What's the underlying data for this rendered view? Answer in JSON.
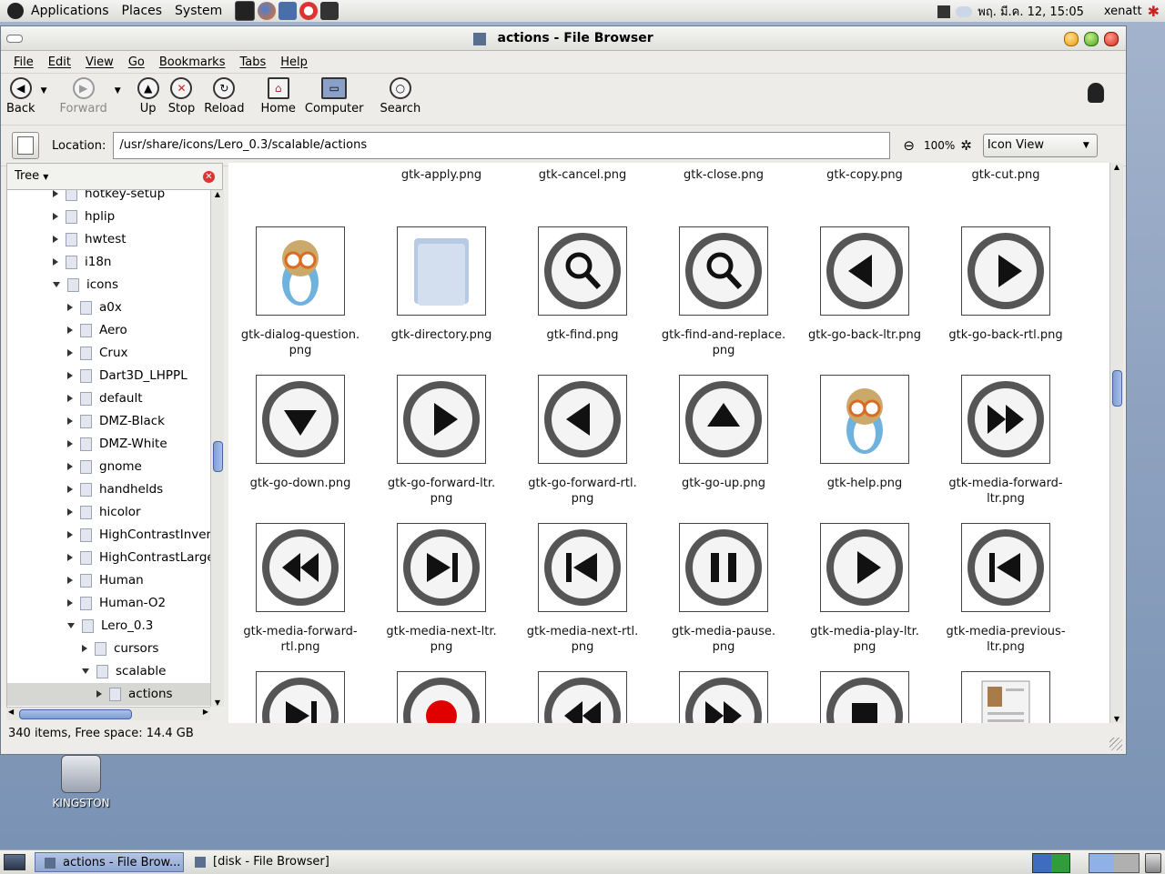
{
  "top_panel": {
    "menus": [
      "Applications",
      "Places",
      "System"
    ],
    "clock": "พฤ. มี.ค. 12, 15:05",
    "user": "xenatt"
  },
  "window": {
    "title": "actions - File Browser",
    "menu": [
      "File",
      "Edit",
      "View",
      "Go",
      "Bookmarks",
      "Tabs",
      "Help"
    ],
    "toolbar": {
      "back": "Back",
      "forward": "Forward",
      "up": "Up",
      "stop": "Stop",
      "reload": "Reload",
      "home": "Home",
      "computer": "Computer",
      "search": "Search"
    },
    "location": {
      "label": "Location:",
      "value": "/usr/share/icons/Lero_0.3/scalable/actions",
      "zoom": "100%",
      "view": "Icon View"
    },
    "side_pane": {
      "selector": "Tree",
      "tree": [
        {
          "label": "hotkey-setup",
          "level": 0,
          "expanded": false
        },
        {
          "label": "hplip",
          "level": 0,
          "expanded": false
        },
        {
          "label": "hwtest",
          "level": 0,
          "expanded": false
        },
        {
          "label": "i18n",
          "level": 0,
          "expanded": false
        },
        {
          "label": "icons",
          "level": 0,
          "expanded": true
        },
        {
          "label": "a0x",
          "level": 1,
          "expanded": false
        },
        {
          "label": "Aero",
          "level": 1,
          "expanded": false
        },
        {
          "label": "Crux",
          "level": 1,
          "expanded": false
        },
        {
          "label": "Dart3D_LHPPL",
          "level": 1,
          "expanded": false
        },
        {
          "label": "default",
          "level": 1,
          "expanded": false
        },
        {
          "label": "DMZ-Black",
          "level": 1,
          "expanded": false
        },
        {
          "label": "DMZ-White",
          "level": 1,
          "expanded": false
        },
        {
          "label": "gnome",
          "level": 1,
          "expanded": false
        },
        {
          "label": "handhelds",
          "level": 1,
          "expanded": false
        },
        {
          "label": "hicolor",
          "level": 1,
          "expanded": false
        },
        {
          "label": "HighContrastInverse",
          "level": 1,
          "expanded": false
        },
        {
          "label": "HighContrastLargePrint",
          "level": 1,
          "expanded": false
        },
        {
          "label": "Human",
          "level": 1,
          "expanded": false
        },
        {
          "label": "Human-O2",
          "level": 1,
          "expanded": false
        },
        {
          "label": "Lero_0.3",
          "level": 1,
          "expanded": true
        },
        {
          "label": "cursors",
          "level": 2,
          "expanded": false
        },
        {
          "label": "scalable",
          "level": 2,
          "expanded": true
        },
        {
          "label": "actions",
          "level": 3,
          "expanded": false,
          "selected": true
        }
      ]
    },
    "top_partial_row": [
      "gtk-apply.png",
      "gtk-cancel.png",
      "gtk-close.png",
      "gtk-copy.png",
      "gtk-cut.png"
    ],
    "files": [
      {
        "label": "gtk-dialog-question.\npng",
        "glyph": "penguin"
      },
      {
        "label": "gtk-directory.png",
        "glyph": "folder"
      },
      {
        "label": "gtk-find.png",
        "glyph": "magnifier"
      },
      {
        "label": "gtk-find-and-replace.\npng",
        "glyph": "magnifier"
      },
      {
        "label": "gtk-go-back-ltr.png",
        "glyph": "left"
      },
      {
        "label": "gtk-go-back-rtl.png",
        "glyph": "right"
      },
      {
        "label": "gtk-go-down.png",
        "glyph": "down"
      },
      {
        "label": "gtk-go-forward-ltr.\npng",
        "glyph": "right"
      },
      {
        "label": "gtk-go-forward-rtl.\npng",
        "glyph": "left"
      },
      {
        "label": "gtk-go-up.png",
        "glyph": "up"
      },
      {
        "label": "gtk-help.png",
        "glyph": "penguin"
      },
      {
        "label": "gtk-media-forward-\nltr.png",
        "glyph": "ff"
      },
      {
        "label": "gtk-media-forward-\nrtl.png",
        "glyph": "rew"
      },
      {
        "label": "gtk-media-next-ltr.\npng",
        "glyph": "next"
      },
      {
        "label": "gtk-media-next-rtl.\npng",
        "glyph": "prev"
      },
      {
        "label": "gtk-media-pause.\npng",
        "glyph": "pause"
      },
      {
        "label": "gtk-media-play-ltr.\npng",
        "glyph": "right"
      },
      {
        "label": "gtk-media-previous-\nltr.png",
        "glyph": "prev"
      },
      {
        "label": "",
        "glyph": "next"
      },
      {
        "label": "",
        "glyph": "record"
      },
      {
        "label": "",
        "glyph": "rew"
      },
      {
        "label": "",
        "glyph": "ff"
      },
      {
        "label": "",
        "glyph": "stop"
      },
      {
        "label": "",
        "glyph": "doc"
      }
    ],
    "status": "340 items, Free space: 14.4 GB"
  },
  "desktop": {
    "icon_label": "KINGSTON"
  },
  "taskbar": {
    "tasks": [
      "actions - File Brow...",
      "[disk - File Browser]"
    ]
  },
  "colors": {
    "accent": "#4766a3",
    "selection": "#d6d6d2",
    "record": "#e00000"
  }
}
